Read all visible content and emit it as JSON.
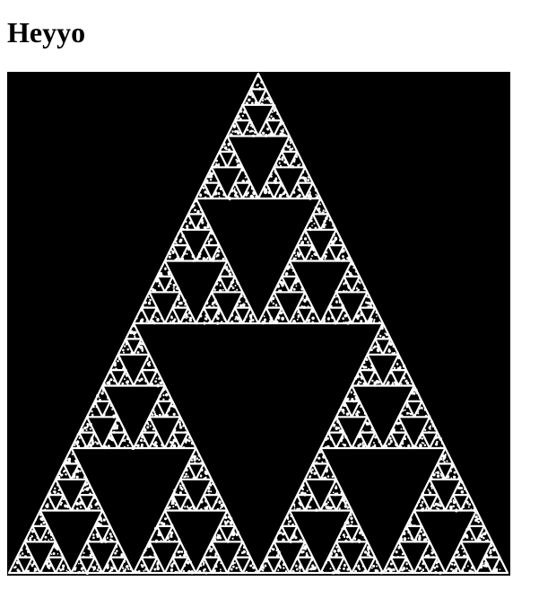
{
  "page": {
    "heading": "Heyyo"
  },
  "fractal_canvas": {
    "description_type": "sierpinski-triangle",
    "background_color": "#000000",
    "point_color": "#ffffff",
    "recursion_depth": 5
  }
}
